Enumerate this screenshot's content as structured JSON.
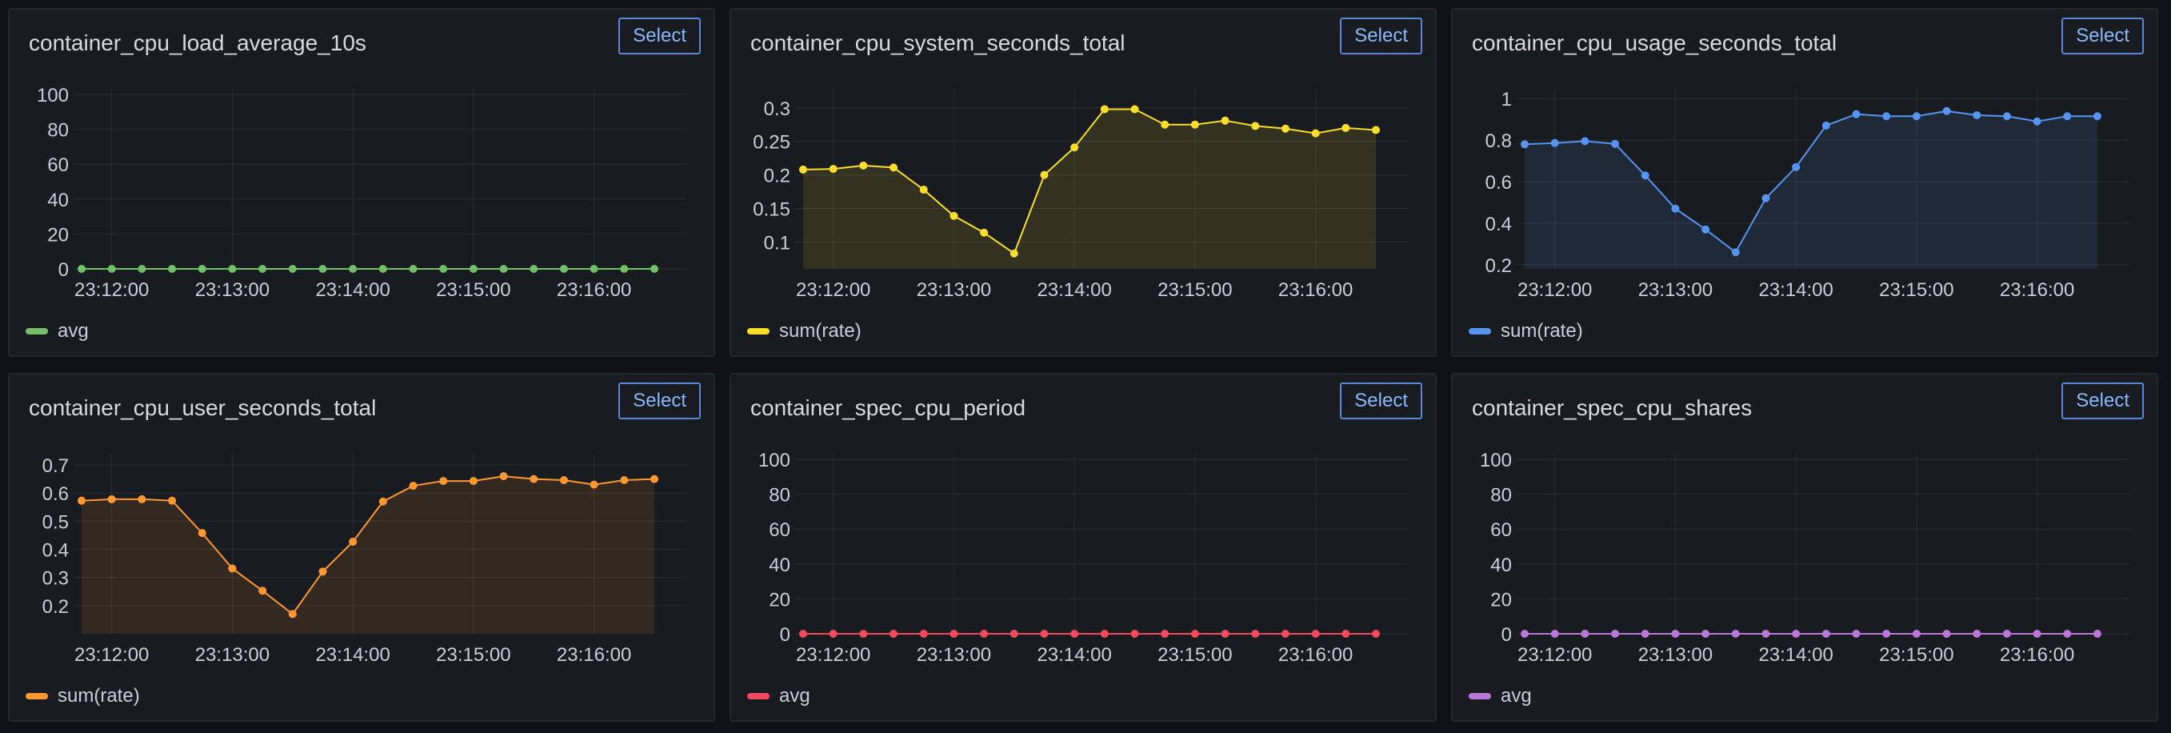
{
  "panels": [
    {
      "title": "container_cpu_load_average_10s",
      "select_label": "Select",
      "legend": "avg",
      "color": "#73bf69",
      "chart_data": {
        "type": "line",
        "fill": false,
        "x_ticks": [
          "23:12:00",
          "23:13:00",
          "23:14:00",
          "23:15:00",
          "23:16:00"
        ],
        "y_ticks": [
          "100",
          "80",
          "60",
          "40",
          "20",
          "0"
        ],
        "ylim": [
          0,
          100
        ],
        "series": [
          {
            "name": "avg",
            "values": [
              0,
              0,
              0,
              0,
              0,
              0,
              0,
              0,
              0,
              0,
              0,
              0,
              0,
              0,
              0,
              0,
              0,
              0,
              0,
              0
            ]
          }
        ]
      }
    },
    {
      "title": "container_cpu_system_seconds_total",
      "select_label": "Select",
      "legend": "sum(rate)",
      "color": "#fade2a",
      "chart_data": {
        "type": "area",
        "fill": true,
        "x_ticks": [
          "23:12:00",
          "23:13:00",
          "23:14:00",
          "23:15:00",
          "23:16:00"
        ],
        "y_ticks": [
          "0.3",
          "0.25",
          "0.2",
          "0.15",
          "0.1"
        ],
        "ylim": [
          0.06,
          0.32
        ],
        "series": [
          {
            "name": "sum(rate)",
            "values": [
              0.208,
              0.209,
              0.214,
              0.211,
              0.178,
              0.139,
              0.114,
              0.083,
              0.2,
              0.241,
              0.298,
              0.298,
              0.275,
              0.275,
              0.281,
              0.273,
              0.269,
              0.262,
              0.27,
              0.267
            ]
          }
        ]
      }
    },
    {
      "title": "container_cpu_usage_seconds_total",
      "select_label": "Select",
      "legend": "sum(rate)",
      "color": "#5794f2",
      "chart_data": {
        "type": "area",
        "fill": true,
        "x_ticks": [
          "23:12:00",
          "23:13:00",
          "23:14:00",
          "23:15:00",
          "23:16:00"
        ],
        "y_ticks": [
          "1",
          "0.8",
          "0.6",
          "0.4",
          "0.2"
        ],
        "ylim": [
          0.18,
          1.02
        ],
        "series": [
          {
            "name": "sum(rate)",
            "values": [
              0.78,
              0.786,
              0.795,
              0.782,
              0.63,
              0.47,
              0.37,
              0.26,
              0.52,
              0.67,
              0.87,
              0.925,
              0.915,
              0.915,
              0.94,
              0.92,
              0.915,
              0.89,
              0.915,
              0.915
            ]
          }
        ]
      }
    },
    {
      "title": "container_cpu_user_seconds_total",
      "select_label": "Select",
      "legend": "sum(rate)",
      "color": "#ff9830",
      "chart_data": {
        "type": "area",
        "fill": true,
        "x_ticks": [
          "23:12:00",
          "23:13:00",
          "23:14:00",
          "23:15:00",
          "23:16:00"
        ],
        "y_ticks": [
          "0.7",
          "0.6",
          "0.5",
          "0.4",
          "0.3",
          "0.2"
        ],
        "ylim": [
          0.1,
          0.72
        ],
        "series": [
          {
            "name": "sum(rate)",
            "values": [
              0.573,
              0.578,
              0.578,
              0.573,
              0.458,
              0.332,
              0.253,
              0.17,
              0.321,
              0.427,
              0.57,
              0.626,
              0.643,
              0.643,
              0.66,
              0.65,
              0.646,
              0.63,
              0.646,
              0.65
            ]
          }
        ]
      }
    },
    {
      "title": "container_spec_cpu_period",
      "select_label": "Select",
      "legend": "avg",
      "color": "#f2495c",
      "chart_data": {
        "type": "line",
        "fill": false,
        "x_ticks": [
          "23:12:00",
          "23:13:00",
          "23:14:00",
          "23:15:00",
          "23:16:00"
        ],
        "y_ticks": [
          "100",
          "80",
          "60",
          "40",
          "20",
          "0"
        ],
        "ylim": [
          0,
          100
        ],
        "series": [
          {
            "name": "avg",
            "values": [
              0,
              0,
              0,
              0,
              0,
              0,
              0,
              0,
              0,
              0,
              0,
              0,
              0,
              0,
              0,
              0,
              0,
              0,
              0,
              0
            ]
          }
        ]
      }
    },
    {
      "title": "container_spec_cpu_shares",
      "select_label": "Select",
      "legend": "avg",
      "color": "#b877d9",
      "chart_data": {
        "type": "line",
        "fill": false,
        "x_ticks": [
          "23:12:00",
          "23:13:00",
          "23:14:00",
          "23:15:00",
          "23:16:00"
        ],
        "y_ticks": [
          "100",
          "80",
          "60",
          "40",
          "20",
          "0"
        ],
        "ylim": [
          0,
          100
        ],
        "series": [
          {
            "name": "avg",
            "values": [
              0,
              0,
              0,
              0,
              0,
              0,
              0,
              0,
              0,
              0,
              0,
              0,
              0,
              0,
              0,
              0,
              0,
              0,
              0,
              0
            ]
          }
        ]
      }
    }
  ]
}
